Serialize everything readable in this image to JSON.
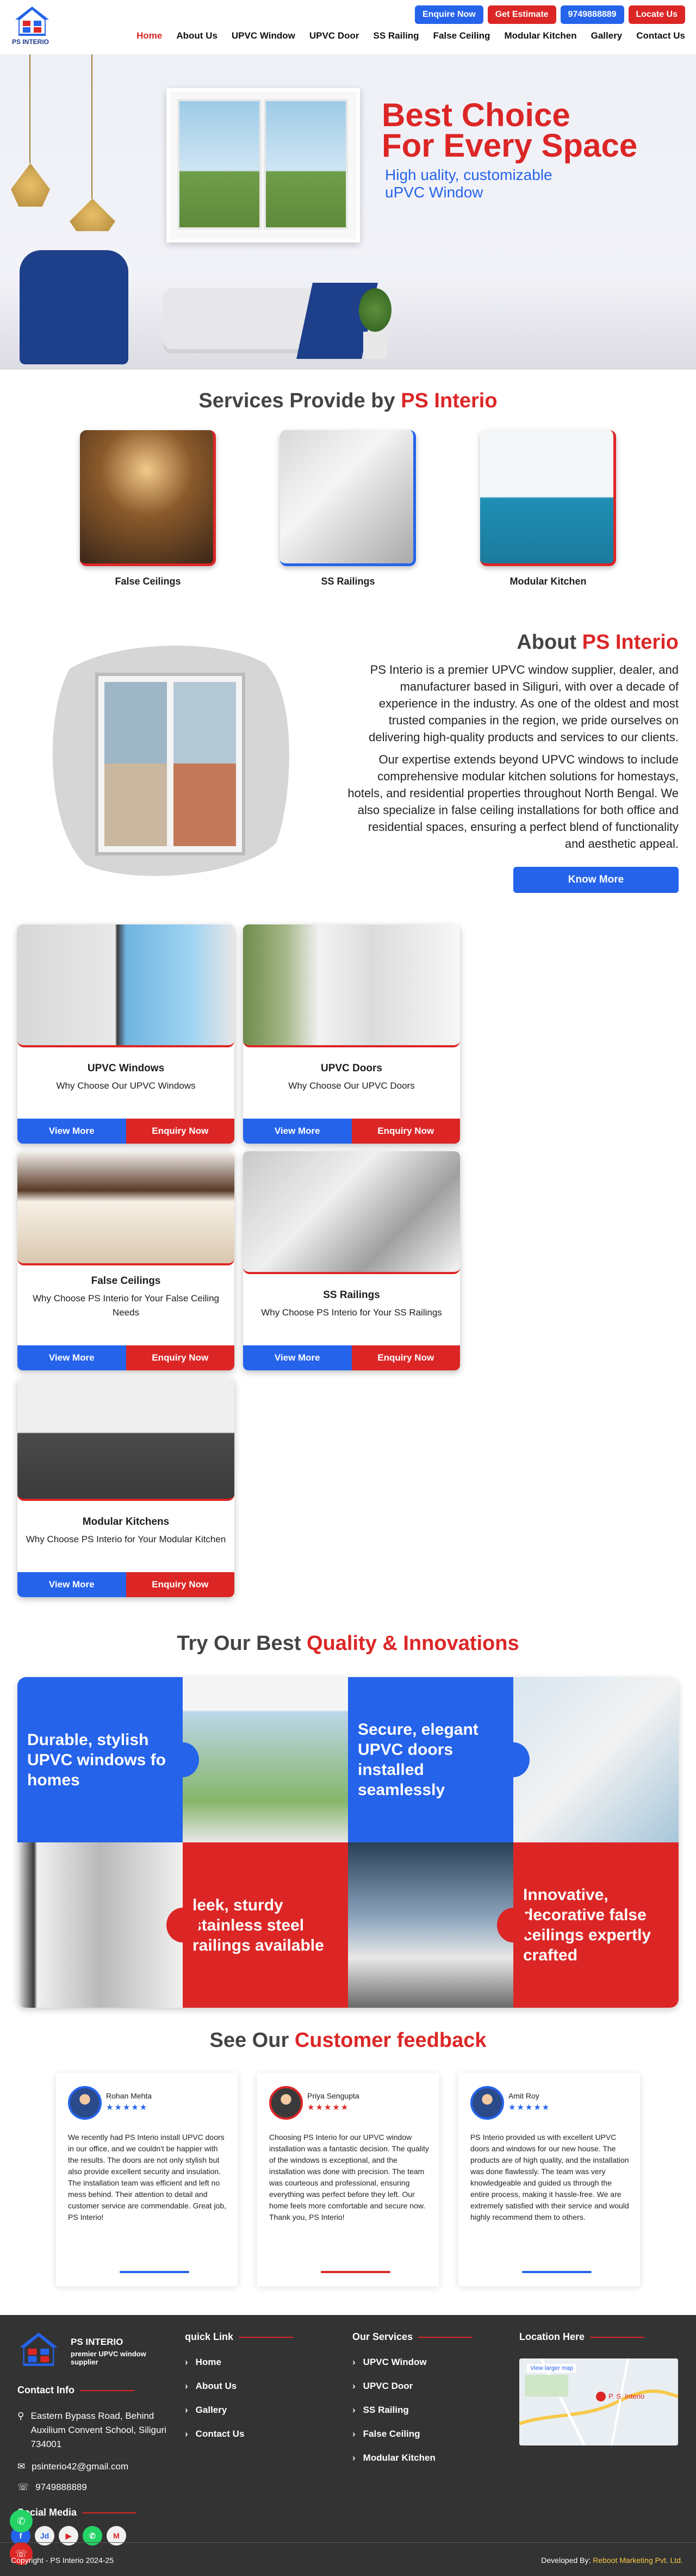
{
  "brand": {
    "logo_text": "PS INTERIO",
    "colors": {
      "blue": "#2563eb",
      "red": "#dc2626"
    }
  },
  "header": {
    "buttons": {
      "enquire": "Enquire Now",
      "estimate": "Get Estimate",
      "phone": "9749888889",
      "locate": "Locate Us"
    },
    "nav": [
      "Home",
      "About Us",
      "UPVC Window",
      "UPVC Door",
      "SS Railing",
      "False Ceiling",
      "Modular Kitchen",
      "Gallery",
      "Contact Us"
    ],
    "active_nav": "Home"
  },
  "hero": {
    "title_line1": "Best Choice",
    "title_line2": "For Every Space",
    "subtitle_line1": "High uality, customizable",
    "subtitle_line2": "uPVC Window"
  },
  "services": {
    "title_pre": "Services Provide by ",
    "title_hl": "PS Interio",
    "items": [
      {
        "label": "False Ceilings"
      },
      {
        "label": "SS Railings"
      },
      {
        "label": "Modular Kitchen"
      }
    ]
  },
  "about": {
    "title_pre": "About ",
    "title_hl": "PS Interio",
    "p1": "PS Interio is a premier UPVC window supplier, dealer, and manufacturer based in Siliguri, with over a decade of experience in the industry. As one of the oldest and most trusted companies in the region, we pride ourselves on delivering high-quality products and services to our clients.",
    "p2": "Our expertise extends beyond UPVC windows to include comprehensive modular kitchen solutions for homestays, hotels, and residential properties throughout North Bengal. We also specialize in false ceiling installations for both office and residential spaces, ensuring a perfect blend of functionality and aesthetic appeal.",
    "button": "Know More"
  },
  "products": {
    "view_label": "View More",
    "enquiry_label": "Enquiry Now",
    "items": [
      {
        "title": "UPVC Windows",
        "desc": "Why Choose Our UPVC Windows"
      },
      {
        "title": "UPVC Doors",
        "desc": "Why Choose Our UPVC Doors"
      },
      {
        "title": "False Ceilings",
        "desc": "Why Choose PS Interio for Your False Ceiling Needs"
      },
      {
        "title": "SS Railings",
        "desc": "Why Choose PS Interio for Your SS Railings"
      },
      {
        "title": "Modular Kitchens",
        "desc": "Why Choose PS Interio for Your Modular Kitchen"
      }
    ]
  },
  "quality": {
    "title_pre": "Try Our Best ",
    "title_hl": "Quality & Innovations",
    "tiles": [
      "Durable, stylish UPVC windows for homes",
      "Secure, elegant UPVC doors installed seamlessly",
      "leek, sturdy stainless steel railings available",
      "Innovative, decorative false ceilings expertly crafted"
    ]
  },
  "feedback": {
    "title_pre": "See Our ",
    "title_hl": "Customer feedback",
    "stars": "★★★★★",
    "items": [
      {
        "name": "Rohan Mehta",
        "text": "We recently had PS Interio install UPVC doors in our office, and we couldn't be happier with the results. The doors are not only stylish but also provide excellent security and insulation. The installation team was efficient and left no mess behind. Their attention to detail and customer service are commendable. Great job, PS Interio!"
      },
      {
        "name": "Priya Sengupta",
        "text": "Choosing PS Interio for our UPVC window installation was a fantastic decision. The quality of the windows is exceptional, and the installation was done with precision. The team was courteous and professional, ensuring everything was perfect before they left. Our home feels more comfortable and secure now. Thank you, PS Interio!"
      },
      {
        "name": "Amit Roy",
        "text": "PS Interio provided us with excellent UPVC doors and windows for our new house. The products are of high quality, and the installation was done flawlessly. The team was very knowledgeable and guided us through the entire process, making it hassle-free. We are extremely satisfied with their service and would highly recommend them to others."
      }
    ]
  },
  "footer": {
    "brand_name": "PS INTERIO",
    "brand_tag": "premier UPVC window supplier",
    "contact_title": "Contact Info",
    "address": "Eastern Bypass Road, Behind Auxilium Convent School, Siliguri 734001",
    "email": "psinterio42@gmail.com",
    "phone": "9749888889",
    "social_title": "Social Media",
    "quick_title": "quick Link",
    "quick_links": [
      "Home",
      "About Us",
      "Gallery",
      "Contact Us"
    ],
    "services_title": "Our Services",
    "service_links": [
      "UPVC Window",
      "UPVC Door",
      "SS Railing",
      "False Ceiling",
      "Modular Kitchen"
    ],
    "location_title": "Location Here",
    "map_link": "View larger map",
    "map_pin": "P. S. Interio",
    "copyright": "Copyright - PS Interio 2024-25",
    "dev_label": "Developed By: ",
    "dev_name": "Reboot Marketing Pvt. Ltd."
  }
}
